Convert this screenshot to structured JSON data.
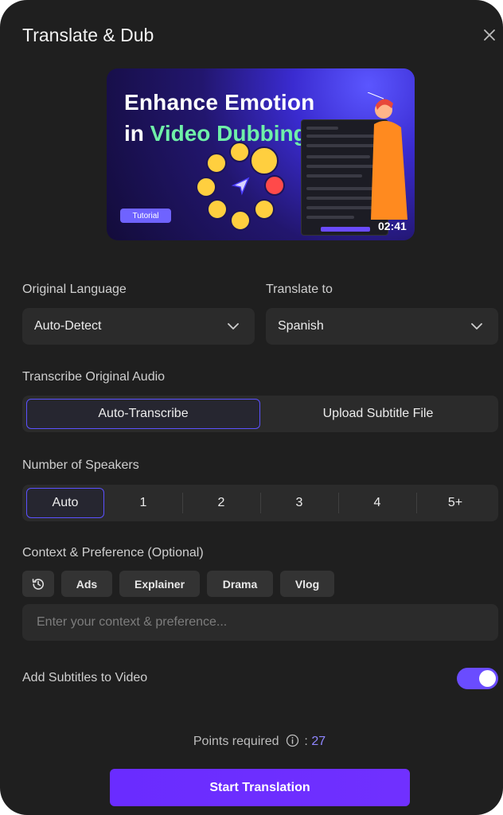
{
  "window": {
    "title": "Translate & Dub"
  },
  "tutorial": {
    "headline_line1": "Enhance Emotion",
    "headline_line2_prefix": "in ",
    "headline_line2_accent": "Video Dubbing",
    "badge": "Tutorial",
    "duration": "02:41"
  },
  "original_language": {
    "label": "Original Language",
    "value": "Auto-Detect"
  },
  "translate_to": {
    "label": "Translate to",
    "value": "Spanish"
  },
  "transcribe": {
    "label": "Transcribe Original Audio",
    "options": [
      "Auto-Transcribe",
      "Upload Subtitle File"
    ],
    "selected": "Auto-Transcribe"
  },
  "speakers": {
    "label": "Number of Speakers",
    "options": [
      "Auto",
      "1",
      "2",
      "3",
      "4",
      "5+"
    ],
    "selected": "Auto"
  },
  "context": {
    "label": "Context & Preference (Optional)",
    "chips": [
      "Ads",
      "Explainer",
      "Drama",
      "Vlog"
    ],
    "placeholder": "Enter your context & preference..."
  },
  "subtitles": {
    "label": "Add Subtitles to Video",
    "enabled": true
  },
  "points": {
    "label": "Points required",
    "separator": ":",
    "value": "27"
  },
  "start_button": {
    "label": "Start Translation"
  },
  "colors": {
    "accent": "#6a4cff",
    "background": "#1f1f1f",
    "accent_text": "#8f86ff",
    "headline_accent": "#6ff0a8"
  },
  "icons": {
    "close": "close-icon",
    "chevron": "chevron-down-icon",
    "history": "history-icon",
    "info": "info-icon"
  }
}
